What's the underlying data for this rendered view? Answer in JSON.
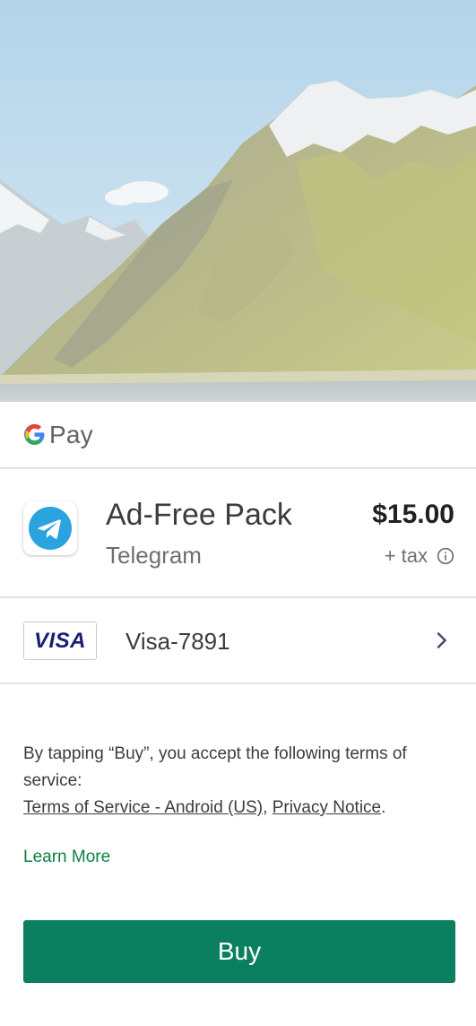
{
  "hero": {
    "image": "mountain-landscape"
  },
  "brand": {
    "pay_label": "Pay",
    "icon": "google-g-icon"
  },
  "product": {
    "name": "Ad-Free Pack",
    "app": "Telegram",
    "price": "$15.00",
    "tax": "+ tax",
    "app_icon": "telegram-icon"
  },
  "payment": {
    "card_brand": "VISA",
    "label": "Visa-7891",
    "icon": "chevron-right-icon"
  },
  "terms": {
    "intro": "By tapping “Buy”, you accept the following terms of service:",
    "tos_link": "Terms of Service - Android (US)",
    "separator": ", ",
    "privacy_link": "Privacy Notice",
    "end": "."
  },
  "learn_more": "Learn More",
  "buy_label": "Buy",
  "colors": {
    "accent_green": "#0b8060",
    "link_green": "#0b8043",
    "visa_blue": "#1a1f71",
    "telegram_blue": "#2aa3df"
  }
}
